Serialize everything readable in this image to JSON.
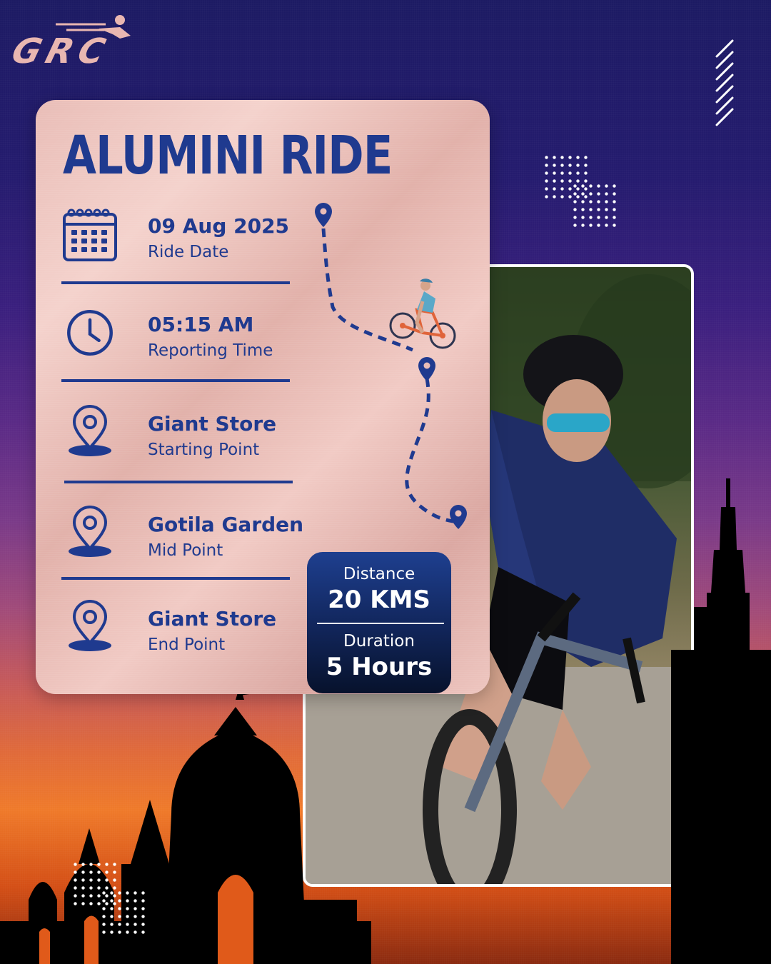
{
  "logo": {
    "text": "GRC"
  },
  "title": "ALUMINI RIDE",
  "details": [
    {
      "value": "09 Aug 2025",
      "label": "Ride Date",
      "icon": "calendar-icon"
    },
    {
      "value": "05:15 AM",
      "label": "Reporting Time",
      "icon": "clock-icon"
    },
    {
      "value": "Giant Store",
      "label": "Starting Point",
      "icon": "location-pin-icon"
    },
    {
      "value": "Gotila Garden",
      "label": "Mid Point",
      "icon": "location-pin-icon"
    },
    {
      "value": "Giant Store",
      "label": "End Point",
      "icon": "location-pin-icon"
    }
  ],
  "stats": {
    "distance_label": "Distance",
    "distance_value": "20 KMS",
    "duration_label": "Duration",
    "duration_value": "5 Hours"
  },
  "colors": {
    "primary_blue": "#1f3a8f",
    "card_rose": "#e9bdb7",
    "logo_rose": "#e9b7b1",
    "sky_top": "#1c1a63",
    "sky_bottom": "#ef7a2a"
  }
}
